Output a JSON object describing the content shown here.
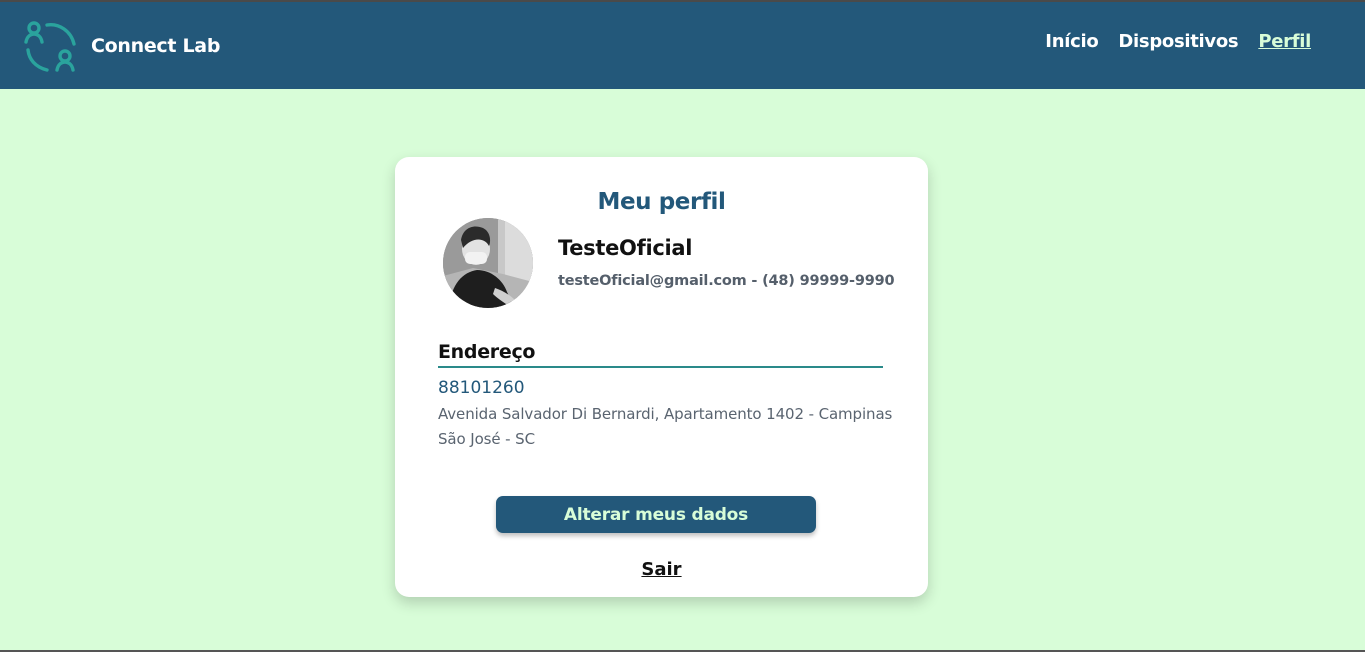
{
  "app": {
    "name": "Connect Lab",
    "logo_icon": "users-connect-icon"
  },
  "nav": {
    "items": [
      {
        "label": "Início",
        "active": false
      },
      {
        "label": "Dispositivos",
        "active": false
      },
      {
        "label": "Perfil",
        "active": true
      }
    ]
  },
  "profile": {
    "title": "Meu perfil",
    "name": "TesteOficial",
    "contact": "testeOficial@gmail.com - (48) 99999-9990",
    "address_section_title": "Endereço",
    "cep": "88101260",
    "address_line1": "Avenida Salvador Di Bernardi, Apartamento 1402 - Campinas",
    "address_line2": "São José - SC",
    "edit_button_label": "Alterar meus dados",
    "logout_label": "Sair"
  },
  "colors": {
    "header_bg": "#23587a",
    "page_bg": "#d8fdd8",
    "accent_teal": "#2a9d9d",
    "button_bg": "#23587a",
    "button_text": "#d8fdd8"
  }
}
